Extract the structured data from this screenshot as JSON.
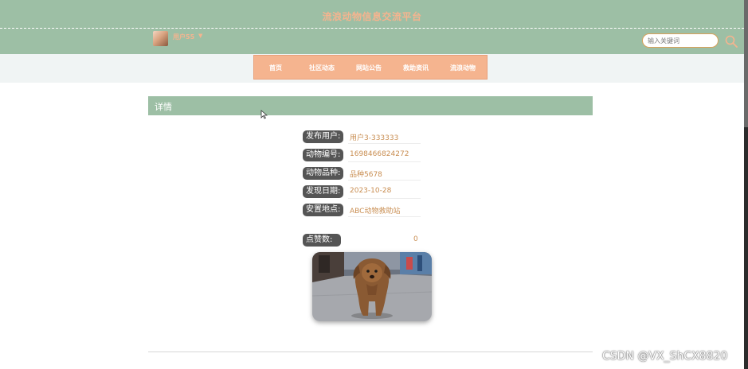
{
  "header": {
    "site_title": "流浪动物信息交流平台",
    "username": "用户55",
    "user_caret": "▼",
    "search_placeholder": "输入关键词"
  },
  "nav": {
    "items": [
      "首页",
      "社区动态",
      "网站公告",
      "救助资讯",
      "流浪动物"
    ]
  },
  "detail": {
    "title": "详情",
    "fields": [
      {
        "label": "发布用户:",
        "value": "用户3-333333"
      },
      {
        "label": "动物编号:",
        "value": "1698466824272"
      },
      {
        "label": "动物品种:",
        "value": "品种5678"
      },
      {
        "label": "发现日期:",
        "value": "2023-10-28"
      },
      {
        "label": "安置地点:",
        "value": "ABC动物救助站"
      }
    ],
    "likes_label": "点赞数:",
    "likes_value": "0"
  },
  "watermark": "CSDN @VX_ShCX8820",
  "colors": {
    "header_green": "#9dbfa5",
    "accent_peach": "#f5b48f",
    "value_brown": "#c98e52",
    "label_gray": "#555555"
  }
}
